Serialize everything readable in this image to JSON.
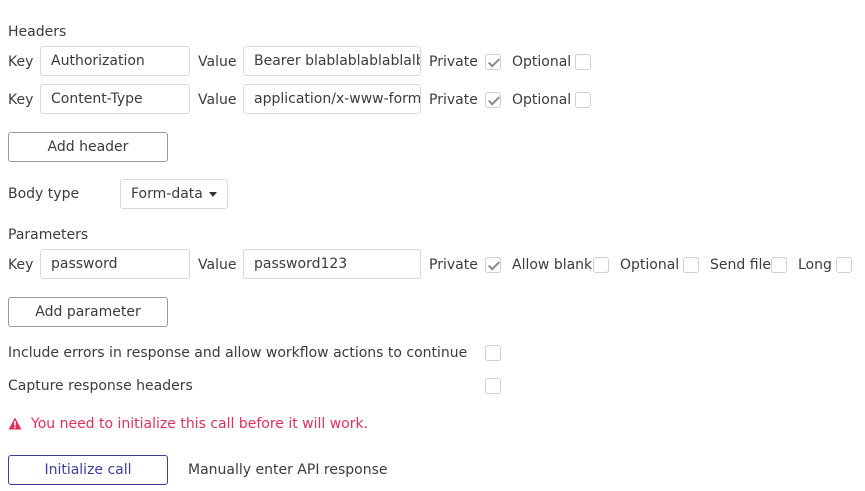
{
  "headers": {
    "title": "Headers",
    "key_label": "Key",
    "value_label": "Value",
    "private_label": "Private",
    "optional_label": "Optional",
    "rows": [
      {
        "key": "Authorization",
        "value": "Bearer blablablablablalbal",
        "private": true,
        "optional": false
      },
      {
        "key": "Content-Type",
        "value": "application/x-www-form-urlencoded",
        "private": true,
        "optional": false
      }
    ],
    "add_button": "Add header"
  },
  "body_type": {
    "label": "Body type",
    "selected": "Form-data"
  },
  "parameters": {
    "title": "Parameters",
    "key_label": "Key",
    "value_label": "Value",
    "private_label": "Private",
    "allow_blank_label": "Allow blank",
    "optional_label": "Optional",
    "send_file_label": "Send file",
    "long_label": "Long",
    "rows": [
      {
        "key": "password",
        "value": "password123",
        "private": true,
        "allow_blank": false,
        "optional": false,
        "send_file": false,
        "long": false
      }
    ],
    "add_button": "Add parameter"
  },
  "options": {
    "include_errors_label": "Include errors in response and allow workflow actions to continue",
    "capture_headers_label": "Capture response headers"
  },
  "warning": {
    "text": "You need to initialize this call before it will work.",
    "color": "#e0305a"
  },
  "actions": {
    "initialize_button": "Initialize call",
    "manual_link": "Manually enter API response"
  }
}
